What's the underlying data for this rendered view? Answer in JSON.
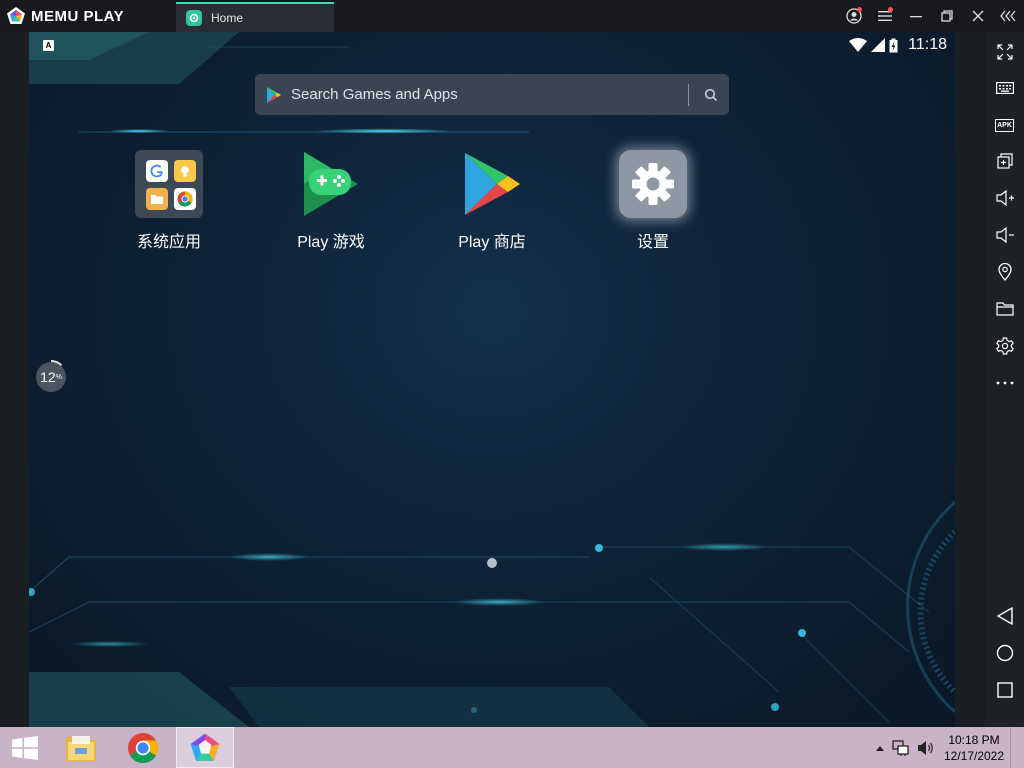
{
  "window": {
    "brand": "MEMU PLAY",
    "tab_label": "Home"
  },
  "android": {
    "status": {
      "notification_letter": "A",
      "clock": "11:18"
    },
    "search": {
      "placeholder": "Search Games and Apps"
    },
    "apps": [
      {
        "label": "系统应用",
        "icon": "folder-icon"
      },
      {
        "label": "Play 游戏",
        "icon": "play-games-icon"
      },
      {
        "label": "Play 商店",
        "icon": "play-store-icon"
      },
      {
        "label": "设置",
        "icon": "settings-gear-icon"
      }
    ],
    "memory_indicator": {
      "value": "12",
      "unit": "%"
    }
  },
  "toolbar": {
    "items": [
      "fullscreen-icon",
      "keyboard-icon",
      "apk-install-icon",
      "multi-instance-icon",
      "volume-up-icon",
      "volume-down-icon",
      "location-icon",
      "folder-icon",
      "settings-icon",
      "more-icon",
      "back-icon",
      "home-icon",
      "recents-icon"
    ],
    "apk_label": "APK"
  },
  "taskbar": {
    "time": "10:18 PM",
    "date": "12/17/2022"
  },
  "colors": {
    "accent": "#3fd6b8",
    "titlebar": "#17191d",
    "taskbar": "#c9b3c6"
  }
}
